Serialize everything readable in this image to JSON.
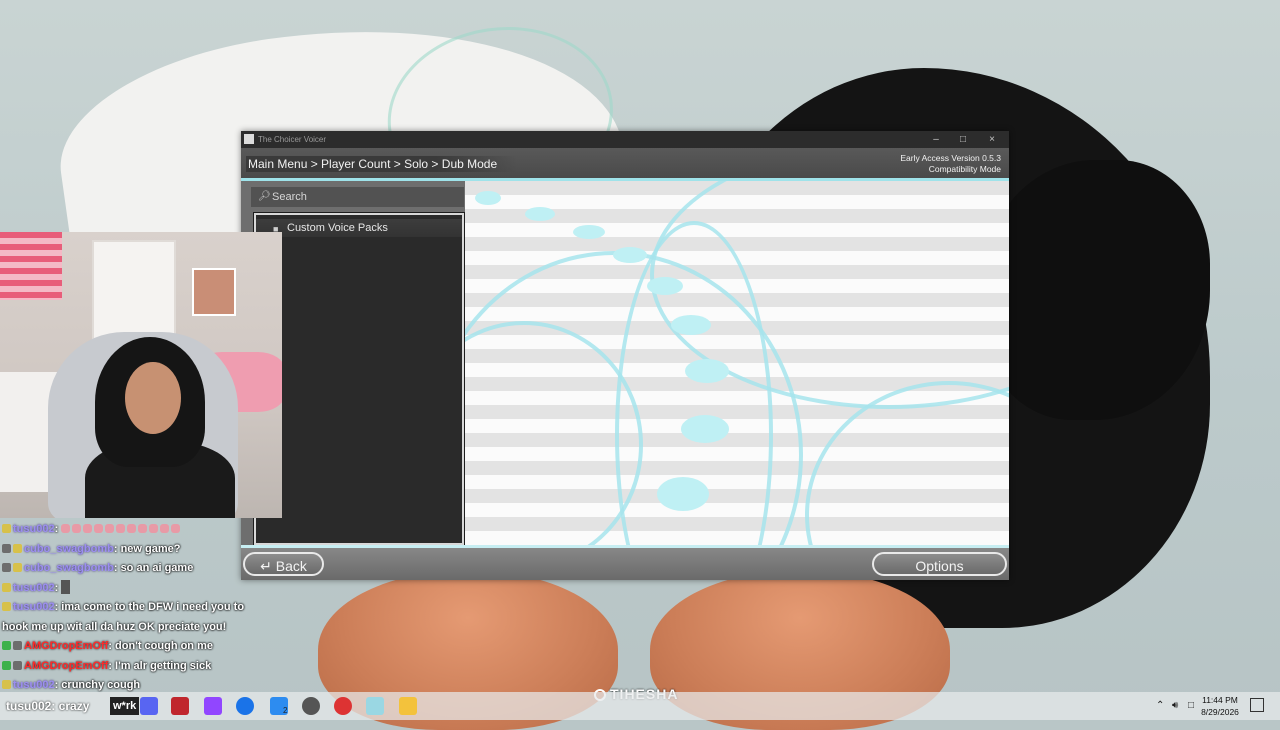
{
  "window": {
    "title": "The Choicer Voicer",
    "minimize": "–",
    "maximize": "□",
    "close": "×"
  },
  "header": {
    "breadcrumb": "Main Menu > Player Count > Solo > Dub Mode",
    "version_line1": "Early Access Version 0.5.3",
    "version_line2": "Compatibility Mode"
  },
  "search": {
    "placeholder": "Search",
    "icon": "search-icon"
  },
  "list": {
    "items": [
      {
        "label": "Custom Voice Packs",
        "icon": "folder-icon"
      }
    ]
  },
  "footer": {
    "back_label": "Back",
    "back_icon": "back-arrow-icon",
    "options_label": "Options"
  },
  "chat": {
    "messages": [
      {
        "user": "tusu002",
        "text": "",
        "user_color": "#9c8ef0"
      },
      {
        "user": "cubo_swagbomb",
        "text": ": new game?",
        "user_color": "#9c8ef0"
      },
      {
        "user": "cubo_swagbomb",
        "text": ": so an ai game",
        "user_color": "#9c8ef0"
      },
      {
        "user": "tusu002",
        "text": ":",
        "user_color": "#9c8ef0"
      },
      {
        "user": "tusu002",
        "text": ": ima come to the DFW i need you to",
        "user_color": "#9c8ef0"
      },
      {
        "user": "",
        "text": "hook me up wit all da huz OK preciate you!",
        "user_color": "#9c8ef0"
      },
      {
        "user": "AMGDropEmOff",
        "text": ": don't cough on me",
        "user_color": "#ff2a2a"
      },
      {
        "user": "AMGDropEmOff",
        "text": ": I'm alr getting sick",
        "user_color": "#ff2a2a"
      },
      {
        "user": "tusu002",
        "text": ": crunchy cough",
        "user_color": "#9c8ef0"
      }
    ]
  },
  "watermark": "TIHESHA",
  "taskbar": {
    "partial_chat": "tusu002: crazy",
    "work_label": "w*rk",
    "badge_count": "2",
    "time": "11:44 PM",
    "date": "8/29/2026"
  }
}
